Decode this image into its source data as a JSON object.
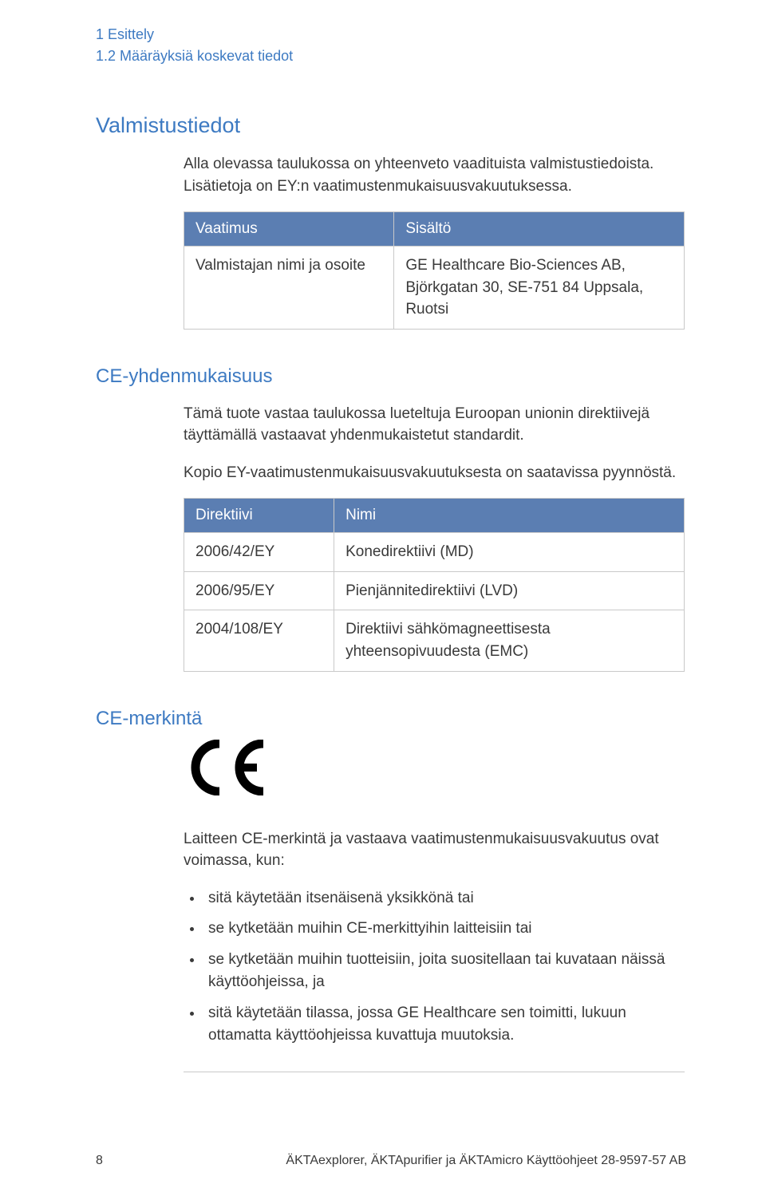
{
  "breadcrumb": {
    "line1": "1 Esittely",
    "line2": "1.2 Määräyksiä koskevat tiedot"
  },
  "sections": {
    "valmistustiedot": {
      "title": "Valmistustiedot",
      "intro": "Alla olevassa taulukossa on yhteenveto vaadituista valmistustiedoista. Lisätietoja on EY:n vaatimustenmukaisuusvakuutuksessa.",
      "table": {
        "headers": {
          "c1": "Vaatimus",
          "c2": "Sisältö"
        },
        "rows": [
          {
            "c1": "Valmistajan nimi ja osoite",
            "c2": "GE Healthcare Bio-Sciences AB, Björkgatan 30, SE-751 84 Uppsala, Ruotsi"
          }
        ]
      }
    },
    "ce_yhden": {
      "title": "CE-yhdenmukaisuus",
      "intro": "Tämä tuote vastaa taulukossa lueteltuja Euroopan unionin direktiivejä täyttämällä vastaavat yhdenmukaistetut standardit.",
      "intro2": "Kopio EY-vaatimustenmukaisuusvakuutuksesta on saatavissa pyynnöstä.",
      "table": {
        "headers": {
          "c1": "Direktiivi",
          "c2": "Nimi"
        },
        "rows": [
          {
            "c1": "2006/42/EY",
            "c2": "Konedirektiivi (MD)"
          },
          {
            "c1": "2006/95/EY",
            "c2": "Pienjännitedirektiivi (LVD)"
          },
          {
            "c1": "2004/108/EY",
            "c2": "Direktiivi sähkömagneettisesta yhteensopivuudesta (EMC)"
          }
        ]
      }
    },
    "ce_merkinta": {
      "title": "CE-merkintä",
      "intro": "Laitteen CE-merkintä ja vastaava vaatimustenmukaisuusvakuutus ovat voimassa, kun:",
      "bullets": [
        "sitä käytetään itsenäisenä yksikkönä tai",
        "se kytketään muihin CE-merkittyihin laitteisiin tai",
        "se kytketään muihin tuotteisiin, joita suositellaan tai kuvataan näissä käyttöohjeissa, ja",
        "sitä käytetään tilassa, jossa GE Healthcare sen toimitti, lukuun ottamatta käyttöohjeissa kuvattuja muutoksia."
      ]
    }
  },
  "footer": {
    "page": "8",
    "doc": "ÄKTAexplorer, ÄKTApurifier ja ÄKTAmicro Käyttöohjeet 28-9597-57 AB"
  }
}
